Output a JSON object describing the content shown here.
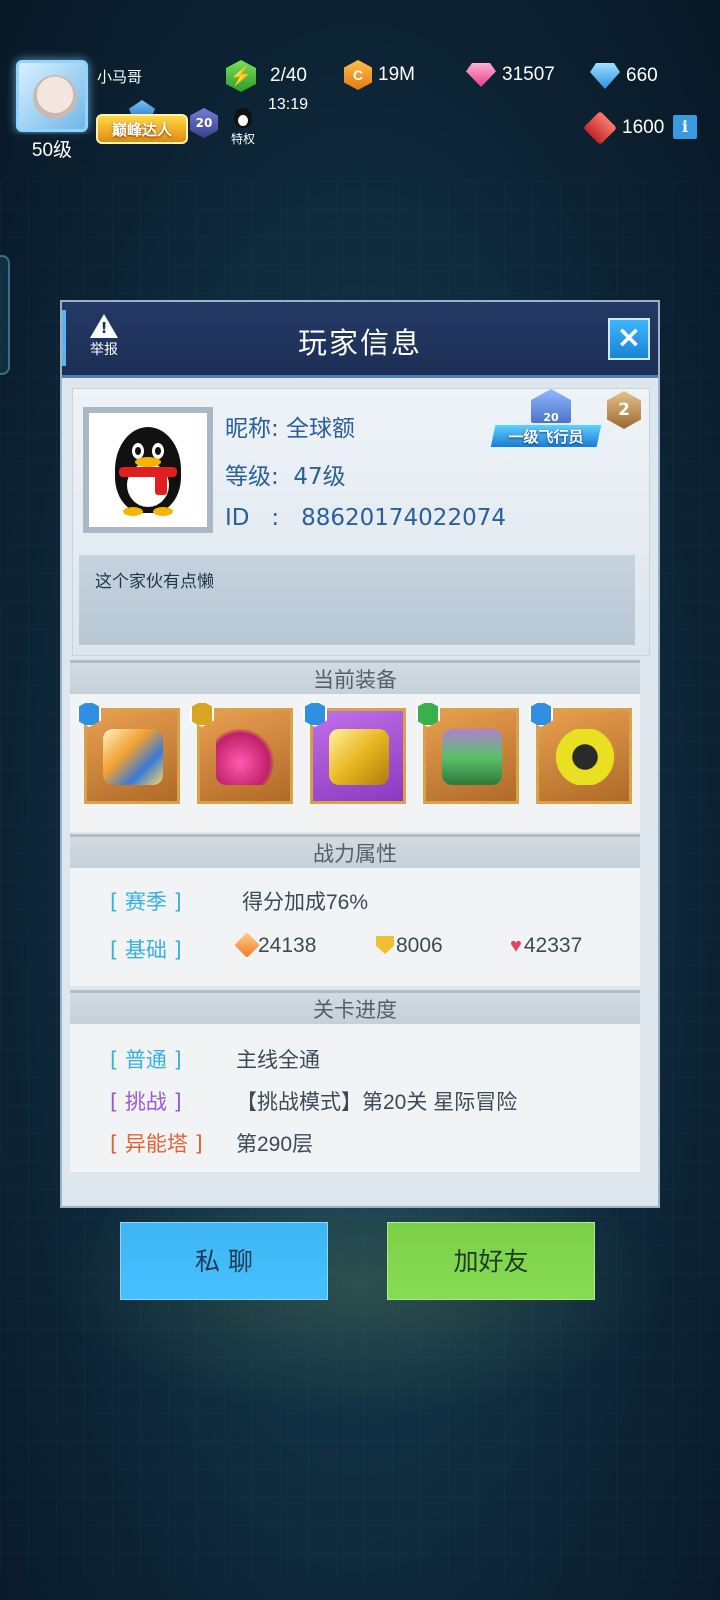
{
  "hud": {
    "player_level": "50级",
    "player_name": "小马哥",
    "title_badge": "巅峰达人",
    "rank_number": "20",
    "privilege_label": "特权",
    "energy": "2/40",
    "energy_timer": "13:19",
    "coins": "19M",
    "pink_gems": "31507",
    "blue_diamonds": "660",
    "red_tokens": "1600",
    "info_icon": "i"
  },
  "dialog": {
    "report_label": "举报",
    "title": "玩家信息",
    "close_icon": "×",
    "profile": {
      "nickname": "昵称: 全球额",
      "level": "等级:  47级",
      "id": "ID   :   88620174022074",
      "rank_emblem_number": "20",
      "rank_emblem_text": "一级飞行员",
      "tier": "2",
      "bio": "这个家伙有点懒"
    },
    "equipment": {
      "header": "当前装备",
      "items": [
        {
          "name": "fighter-ship",
          "rarity": "blue"
        },
        {
          "name": "pink-claw",
          "rarity": "gold"
        },
        {
          "name": "gold-chip",
          "rarity": "blue"
        },
        {
          "name": "green-mech",
          "rarity": "green"
        },
        {
          "name": "yellow-drone",
          "rarity": "blue"
        }
      ]
    },
    "combat": {
      "header": "战力属性",
      "season_label": "[ 赛季 ]",
      "season_value": "得分加成76%",
      "base_label": "[ 基础 ]",
      "attack": "24138",
      "defense": "8006",
      "health": "42337"
    },
    "progress": {
      "header": "关卡进度",
      "normal_label": "[ 普通 ]",
      "normal_value": "主线全通",
      "challenge_label": "[ 挑战 ]",
      "challenge_value": "【挑战模式】第20关 星际冒险",
      "tower_label": "[ 异能塔 ]",
      "tower_value": "第290层"
    }
  },
  "buttons": {
    "chat": "私 聊",
    "add_friend": "加好友"
  },
  "colors": {
    "label_blue": "#3ab0e0",
    "label_purple": "#9a5ad0",
    "label_orange": "#e0643a",
    "header_blue": "#1c2e55",
    "chat_button": "#3db6f2",
    "add_button": "#7bd048"
  }
}
